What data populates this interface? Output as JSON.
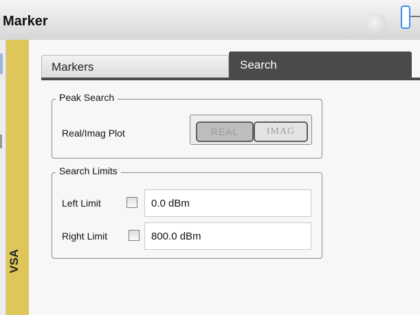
{
  "window": {
    "title": "Marker"
  },
  "side_tab": {
    "label": "VSA"
  },
  "tabs": [
    {
      "label": "Markers",
      "active": false
    },
    {
      "label": "Search",
      "active": true
    }
  ],
  "peak_search": {
    "group_title": "Peak Search",
    "plot_label": "Real/Imag Plot",
    "options": [
      "REAL",
      "IMAG"
    ],
    "selected": "REAL"
  },
  "search_limits": {
    "group_title": "Search Limits",
    "left_limit": {
      "label": "Left Limit",
      "checked": false,
      "value": "0.0 dBm"
    },
    "right_limit": {
      "label": "Right Limit",
      "checked": false,
      "value": "800.0 dBm"
    }
  },
  "colors": {
    "side_tab": "#dec65a",
    "active_tab": "#4a4a4a"
  }
}
